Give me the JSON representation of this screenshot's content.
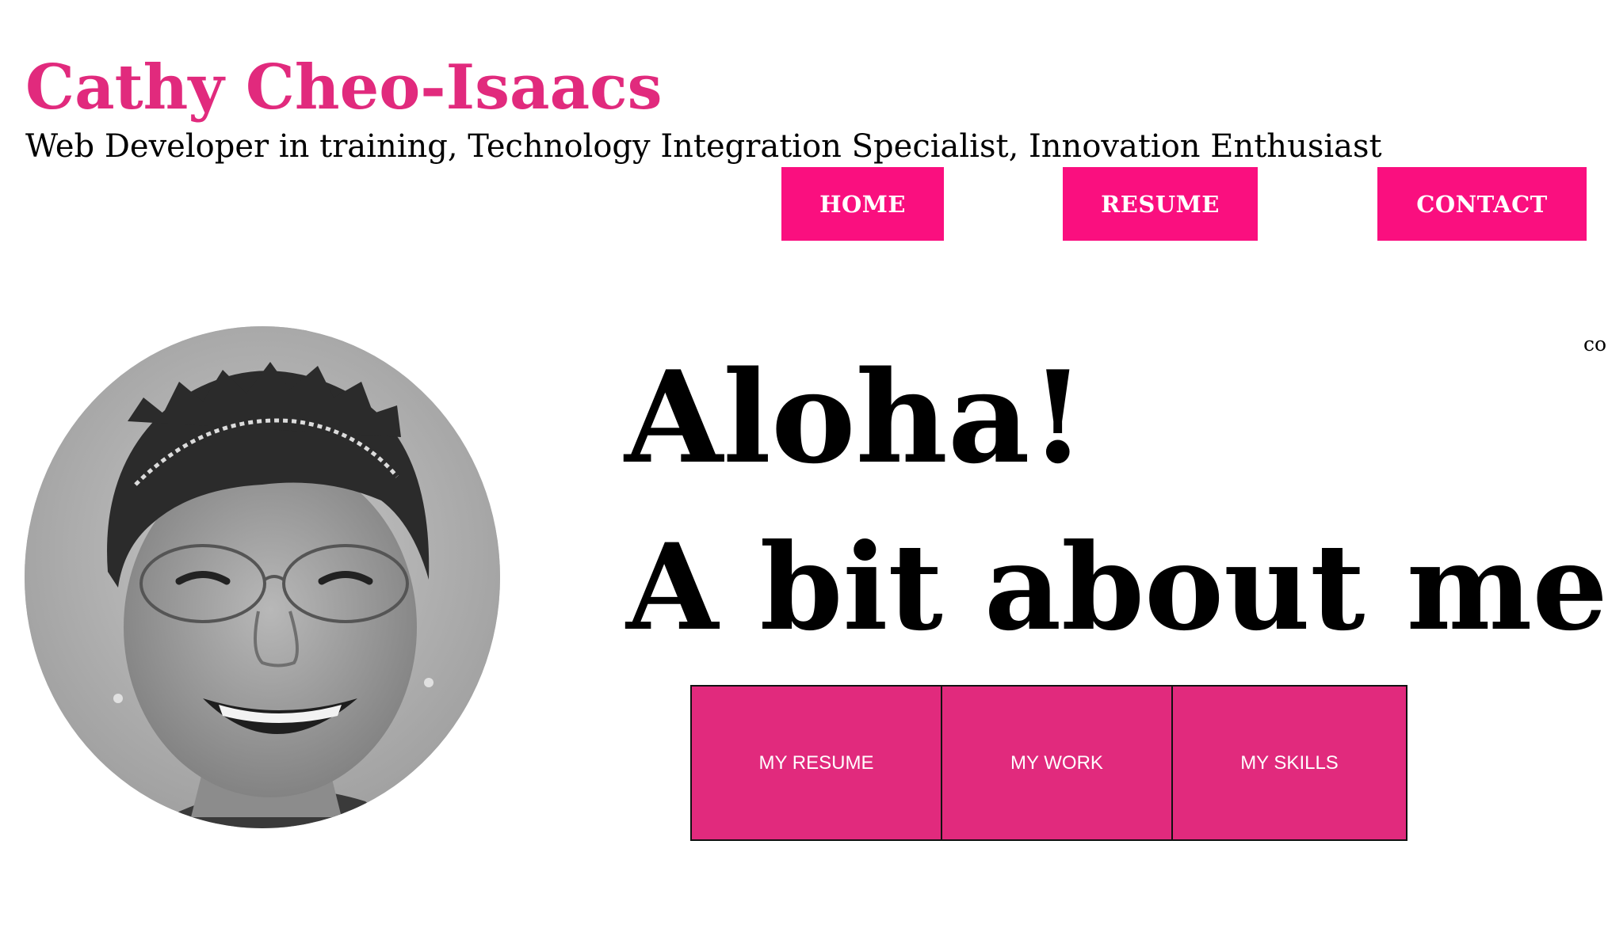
{
  "header": {
    "site_name": "Cathy Cheo-Isaacs",
    "tagline": "Web Developer in training, Technology Integration Specialist, Innovation Enthusiast"
  },
  "nav": {
    "items": [
      {
        "label": "HOME"
      },
      {
        "label": "RESUME"
      },
      {
        "label": "CONTACT"
      }
    ]
  },
  "clipped_text": "co",
  "main": {
    "greeting": "Aloha!",
    "about_heading": "A bit about me:",
    "tiles": [
      {
        "label": "MY RESUME"
      },
      {
        "label": "MY WORK"
      },
      {
        "label": "MY SKILLS"
      }
    ]
  },
  "colors": {
    "brand_pink": "#e12a7d",
    "nav_pink": "#fa0f7f",
    "text": "#000000",
    "background": "#ffffff"
  },
  "icons": {
    "profile_photo": "profile-photo"
  }
}
